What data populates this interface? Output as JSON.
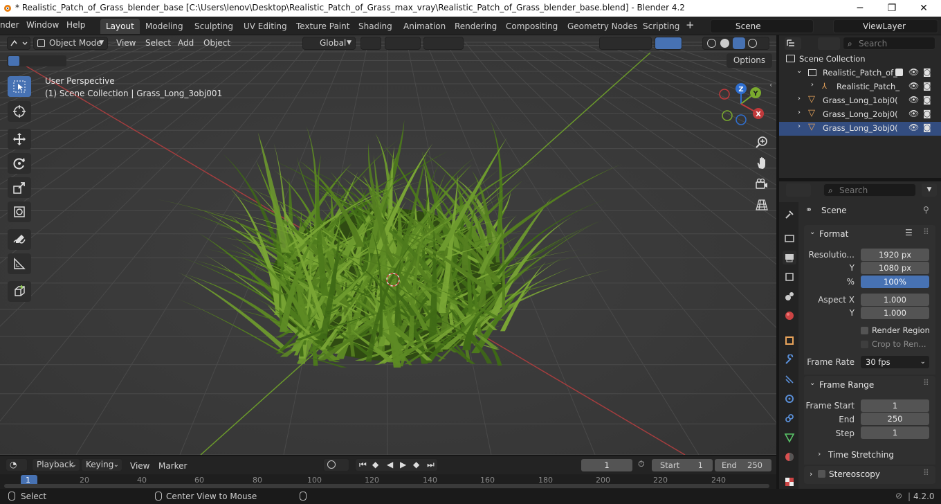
{
  "titlebar": {
    "title": "* Realistic_Patch_of_Grass_blender_base [C:\\Users\\lenov\\Desktop\\Realistic_Patch_of_Grass_max_vray\\Realistic_Patch_of_Grass_blender_base.blend] - Blender 4.2",
    "minimize": "─",
    "maximize": "❐",
    "close": "✕"
  },
  "menu": [
    "nder",
    "Window",
    "Help"
  ],
  "workspaces": [
    "Layout",
    "Modeling",
    "Sculpting",
    "UV Editing",
    "Texture Paint",
    "Shading",
    "Animation",
    "Rendering",
    "Compositing",
    "Geometry Nodes",
    "Scripting"
  ],
  "add_workspace": "+",
  "scene_field": "Scene",
  "viewlayer_field": "ViewLayer",
  "viewport_header": {
    "mode": "Object Mode",
    "menus": [
      "View",
      "Select",
      "Add",
      "Object"
    ],
    "orientation": "Global",
    "options": "Options"
  },
  "overlay_text": {
    "perspective": "User Perspective",
    "collection": "(1) Scene Collection | Grass_Long_3obj001"
  },
  "gizmo": {
    "z": "Z",
    "y": "Y",
    "x": "X"
  },
  "outliner": {
    "search_placeholder": "Search",
    "root": "Scene Collection",
    "items": [
      {
        "label": "Realistic_Patch_of_"
      },
      {
        "label": "Realistic_Patch_"
      },
      {
        "label": "Grass_Long_1obj0("
      },
      {
        "label": "Grass_Long_2obj0("
      },
      {
        "label": "Grass_Long_3obj0("
      }
    ]
  },
  "properties": {
    "search_placeholder": "Search",
    "context": "Scene",
    "format": {
      "title": "Format",
      "resolution_label": "Resolutio...",
      "res_x": "1920 px",
      "y_label": "Y",
      "res_y": "1080 px",
      "pct_label": "%",
      "pct": "100%",
      "aspect_label": "Aspect X",
      "aspect_x": "1.000",
      "aspect_y_label": "Y",
      "aspect_y": "1.000",
      "render_region": "Render Region",
      "crop": "Crop to Ren...",
      "frame_rate_label": "Frame Rate",
      "frame_rate": "30 fps"
    },
    "frame_range": {
      "title": "Frame Range",
      "start_label": "Frame Start",
      "start": "1",
      "end_label": "End",
      "end": "250",
      "step_label": "Step",
      "step": "1",
      "time_stretching": "Time Stretching"
    },
    "stereoscopy": "Stereoscopy"
  },
  "timeline": {
    "menus": [
      "Playback",
      "Keying",
      "View",
      "Marker"
    ],
    "current_frame": "1",
    "start_label": "Start",
    "start": "1",
    "end_label": "End",
    "end": "250",
    "ticks": [
      "1",
      "20",
      "40",
      "60",
      "80",
      "100",
      "120",
      "140",
      "160",
      "180",
      "200",
      "220",
      "240"
    ]
  },
  "statusbar": {
    "select": "Select",
    "center": "Center View to Mouse",
    "version": "4.2.0"
  },
  "colors": {
    "accent": "#4772b3",
    "x_axis": "#c0393b",
    "y_axis": "#7aaa2e",
    "z_axis": "#2f6fd0",
    "grass": "#5d8a24"
  }
}
